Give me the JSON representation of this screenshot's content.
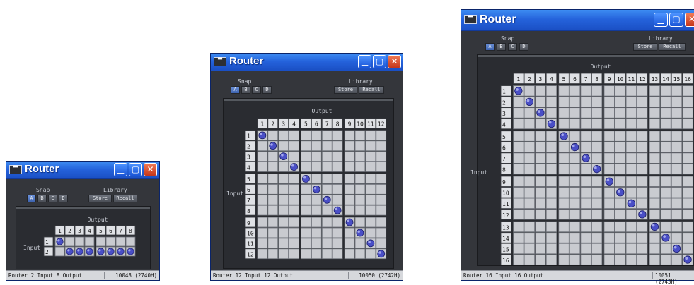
{
  "windows": [
    {
      "title": "Router",
      "snap_label": "Snap",
      "snap_buttons": [
        "A",
        "B",
        "C",
        "D"
      ],
      "snap_active": "A",
      "library_label": "Library",
      "store_label": "Store",
      "recall_label": "Recall",
      "output_label": "Output",
      "input_label": "Input",
      "inputs": 2,
      "outputs": 8,
      "routes": [
        [
          1,
          1
        ],
        [
          2,
          2
        ],
        [
          2,
          3
        ],
        [
          2,
          4
        ],
        [
          2,
          5
        ],
        [
          2,
          6
        ],
        [
          2,
          7
        ],
        [
          2,
          8
        ]
      ],
      "status_left": "Router  2 Input 8 Output",
      "status_right": "10048 (2740H)"
    },
    {
      "title": "Router",
      "snap_label": "Snap",
      "snap_buttons": [
        "A",
        "B",
        "C",
        "D"
      ],
      "snap_active": "A",
      "library_label": "Library",
      "store_label": "Store",
      "recall_label": "Recall",
      "output_label": "Output",
      "input_label": "Input",
      "inputs": 12,
      "outputs": 12,
      "routes": [
        [
          1,
          1
        ],
        [
          2,
          2
        ],
        [
          3,
          3
        ],
        [
          4,
          4
        ],
        [
          5,
          5
        ],
        [
          6,
          6
        ],
        [
          7,
          7
        ],
        [
          8,
          8
        ],
        [
          9,
          9
        ],
        [
          10,
          10
        ],
        [
          11,
          11
        ],
        [
          12,
          12
        ]
      ],
      "status_left": "Router  12 Input 12 Output",
      "status_right": "10050 (2742H)"
    },
    {
      "title": "Router",
      "snap_label": "Snap",
      "snap_buttons": [
        "A",
        "B",
        "C",
        "D"
      ],
      "snap_active": "A",
      "library_label": "Library",
      "store_label": "Store",
      "recall_label": "Recall",
      "output_label": "Output",
      "input_label": "Input",
      "inputs": 16,
      "outputs": 16,
      "routes": [
        [
          1,
          1
        ],
        [
          2,
          2
        ],
        [
          3,
          3
        ],
        [
          4,
          4
        ],
        [
          5,
          5
        ],
        [
          6,
          6
        ],
        [
          7,
          7
        ],
        [
          8,
          8
        ],
        [
          9,
          9
        ],
        [
          10,
          10
        ],
        [
          11,
          11
        ],
        [
          12,
          12
        ],
        [
          13,
          13
        ],
        [
          14,
          14
        ],
        [
          15,
          15
        ],
        [
          16,
          16
        ]
      ],
      "status_left": "Router  16 Input 16 Output",
      "status_right": "10051 (2743H)"
    }
  ],
  "colors": {
    "window_bg": "#34363b",
    "cell": "#c9cbd0",
    "cell_border": "#6d7078",
    "header_cell": "#dfe1e5",
    "header_text": "#111111",
    "route_dot": "#4a4fc6",
    "titlebar": "#2563dc"
  },
  "icons": {
    "app_icon": "yamaha-editor-icon",
    "minimize": "minimize-icon",
    "maximize": "maximize-icon",
    "close": "close-icon"
  }
}
